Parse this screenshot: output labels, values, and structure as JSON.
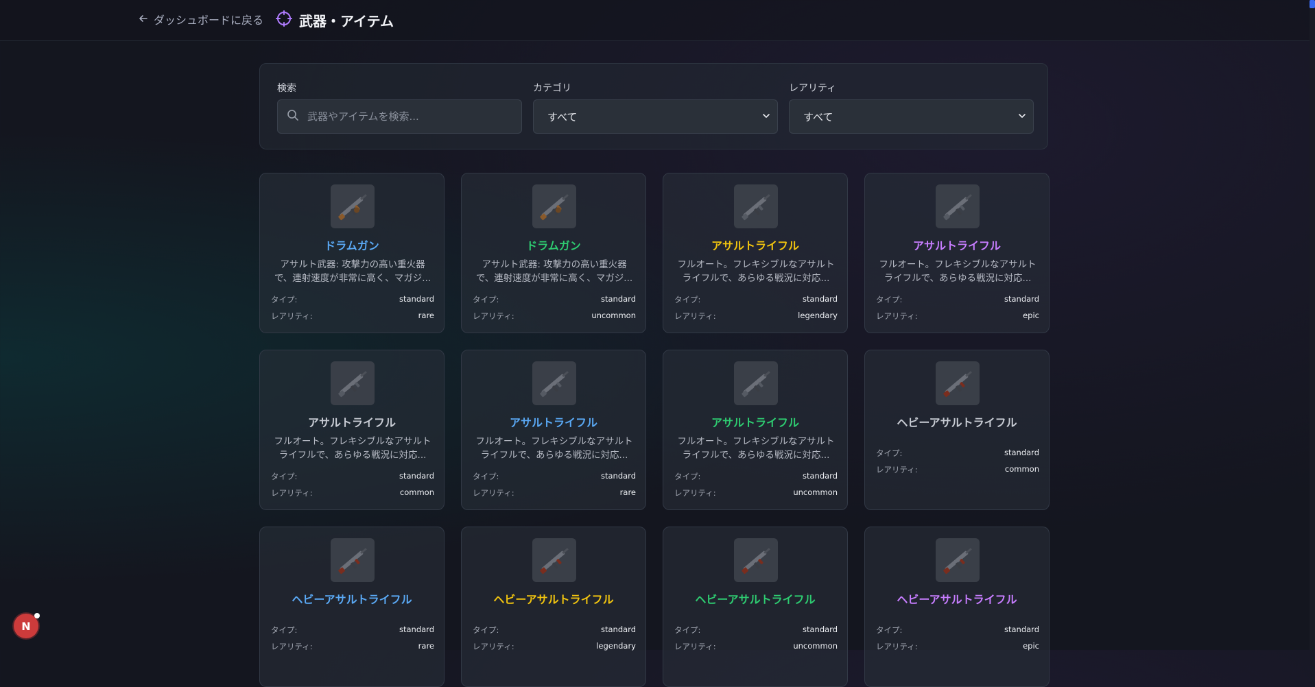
{
  "header": {
    "back_label": "ダッシュボードに戻る",
    "title": "武器・アイテム",
    "title_icon": "crosshair-icon"
  },
  "filters": {
    "search_label": "検索",
    "search_placeholder": "武器やアイテムを検索...",
    "search_value": "",
    "category_label": "カテゴリ",
    "category_value": "すべて",
    "rarity_label": "レアリティ",
    "rarity_value": "すべて"
  },
  "labels": {
    "type": "タイプ:",
    "rarity": "レアリティ:"
  },
  "colors": {
    "rare": "#5aa9f5",
    "uncommon": "#2ecc71",
    "legendary": "#f1c40f",
    "epic": "#c77dff",
    "common": "#c8ccd4"
  },
  "items": [
    {
      "name": "ドラムガン",
      "desc": "アサルト武器: 攻撃力の高い重火器で、連射速度が非常に高く、マガジ...",
      "type": "standard",
      "rarity": "rare",
      "icon": "drum-gun-icon"
    },
    {
      "name": "ドラムガン",
      "desc": "アサルト武器: 攻撃力の高い重火器で、連射速度が非常に高く、マガジ...",
      "type": "standard",
      "rarity": "uncommon",
      "icon": "drum-gun-icon"
    },
    {
      "name": "アサルトライフル",
      "desc": "フルオート。フレキシブルなアサルトライフルで、あらゆる戦況に対応...",
      "type": "standard",
      "rarity": "legendary",
      "icon": "assault-rifle-icon"
    },
    {
      "name": "アサルトライフル",
      "desc": "フルオート。フレキシブルなアサルトライフルで、あらゆる戦況に対応...",
      "type": "standard",
      "rarity": "epic",
      "icon": "assault-rifle-icon"
    },
    {
      "name": "アサルトライフル",
      "desc": "フルオート。フレキシブルなアサルトライフルで、あらゆる戦況に対応...",
      "type": "standard",
      "rarity": "common",
      "icon": "assault-rifle-icon"
    },
    {
      "name": "アサルトライフル",
      "desc": "フルオート。フレキシブルなアサルトライフルで、あらゆる戦況に対応...",
      "type": "standard",
      "rarity": "rare",
      "icon": "assault-rifle-icon"
    },
    {
      "name": "アサルトライフル",
      "desc": "フルオート。フレキシブルなアサルトライフルで、あらゆる戦況に対応...",
      "type": "standard",
      "rarity": "uncommon",
      "icon": "assault-rifle-icon"
    },
    {
      "name": "ヘビーアサルトライフル",
      "desc": "",
      "type": "standard",
      "rarity": "common",
      "icon": "heavy-assault-rifle-icon"
    },
    {
      "name": "ヘビーアサルトライフル",
      "desc": "",
      "type": "standard",
      "rarity": "rare",
      "icon": "heavy-assault-rifle-icon"
    },
    {
      "name": "ヘビーアサルトライフル",
      "desc": "",
      "type": "standard",
      "rarity": "legendary",
      "icon": "heavy-assault-rifle-icon"
    },
    {
      "name": "ヘビーアサルトライフル",
      "desc": "",
      "type": "standard",
      "rarity": "uncommon",
      "icon": "heavy-assault-rifle-icon"
    },
    {
      "name": "ヘビーアサルトライフル",
      "desc": "",
      "type": "standard",
      "rarity": "epic",
      "icon": "heavy-assault-rifle-icon"
    }
  ],
  "badge": {
    "letter": "N"
  }
}
